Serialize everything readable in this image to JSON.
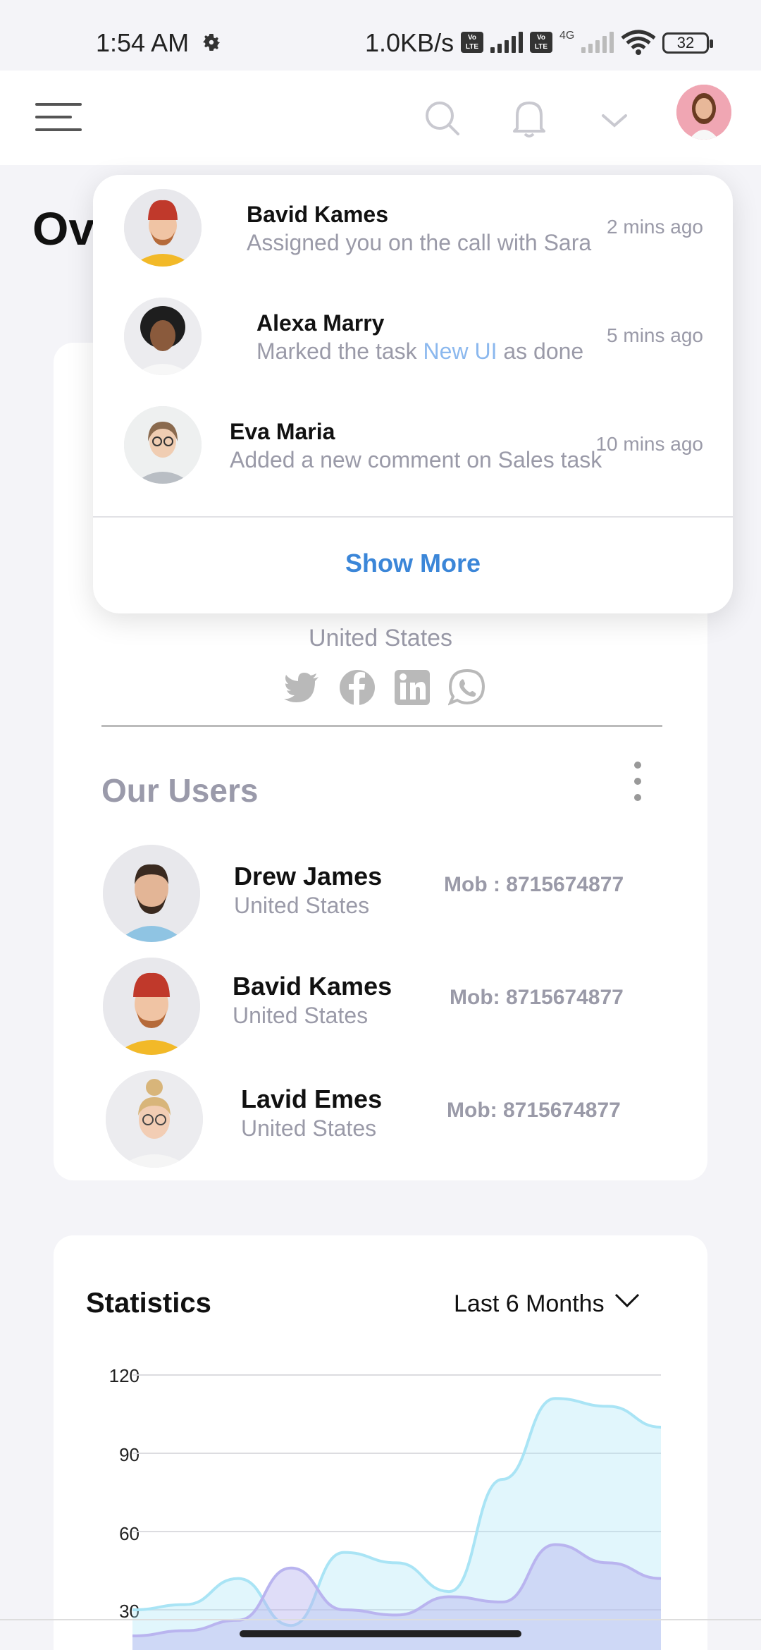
{
  "status_bar": {
    "time": "1:54 AM",
    "net_speed": "1.0KB/s",
    "volte_label": "Vo LTE",
    "network_type": "4G",
    "battery": "32",
    "icons": [
      "gear-icon",
      "volte-icon",
      "signal-icon",
      "wifi-icon",
      "battery-icon"
    ]
  },
  "header": {
    "icons": [
      "menu-icon",
      "search-icon",
      "bell-icon",
      "chevron-down-icon",
      "profile-avatar"
    ]
  },
  "page": {
    "title_visible": "Ov"
  },
  "profile_card": {
    "country": "United States",
    "socials": [
      "twitter-icon",
      "facebook-icon",
      "linkedin-icon",
      "whatsapp-icon"
    ]
  },
  "users": {
    "title": "Our Users",
    "items": [
      {
        "name": "Drew James",
        "country": "United States",
        "mobile": "Mob : 8715674877"
      },
      {
        "name": "Bavid Kames",
        "country": "United States",
        "mobile": "Mob: 8715674877"
      },
      {
        "name": "Lavid Emes",
        "country": "United States",
        "mobile": "Mob: 8715674877"
      }
    ]
  },
  "statistics": {
    "title": "Statistics",
    "range": "Last 6 Months",
    "colors": {
      "series_a": "#a9e4f5",
      "series_b": "#b9b4ef"
    }
  },
  "chart_data": {
    "type": "area",
    "title": "Statistics",
    "ylim": [
      0,
      120
    ],
    "yticks": [
      "120",
      "90",
      "60",
      "30"
    ],
    "grid": true,
    "x": [
      0,
      1,
      2,
      3,
      4,
      5,
      6,
      7,
      8,
      9,
      10
    ],
    "series": [
      {
        "values": [
          30,
          32,
          42,
          24,
          52,
          48,
          37,
          80,
          111,
          108,
          100
        ]
      },
      {
        "values": [
          20,
          22,
          26,
          46,
          30,
          28,
          35,
          33,
          55,
          48,
          42
        ]
      }
    ]
  },
  "notifications": {
    "items": [
      {
        "name": "Bavid Kames",
        "message": "Assigned you on the call with Sara",
        "time": "2 mins ago"
      },
      {
        "name": "Alexa Marry",
        "message_prefix": "Marked the task ",
        "message_link": "New UI",
        "message_suffix": " as done",
        "time": "5 mins ago"
      },
      {
        "name": "Eva Maria",
        "message": "Added a new comment on Sales task",
        "time": "10 mins ago"
      }
    ],
    "show_more": "Show More"
  }
}
